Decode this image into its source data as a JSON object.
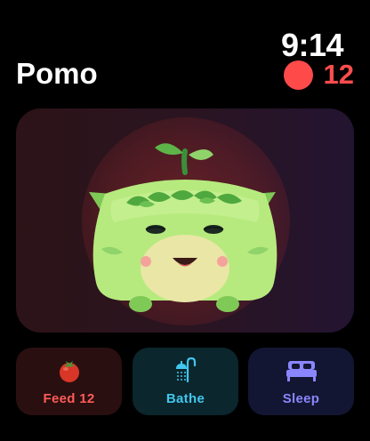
{
  "status_bar": {
    "time": "9:14"
  },
  "header": {
    "title": "Pomo",
    "badge_count": "12"
  },
  "pet": {
    "name": "Pomo",
    "mood": "happy",
    "icon": "pet-character"
  },
  "actions": [
    {
      "label": "Feed 12",
      "icon": "tomato-icon",
      "color": "#ff5b57"
    },
    {
      "label": "Bathe",
      "icon": "shower-icon",
      "color": "#42c7ee"
    },
    {
      "label": "Sleep",
      "icon": "bed-icon",
      "color": "#8a86ff"
    }
  ],
  "colors": {
    "badge": "#ff4a4a",
    "feed_bg": "#2a0f10",
    "bathe_bg": "#0b262c",
    "sleep_bg": "#131632",
    "pet_body": "#b6ea7e"
  }
}
